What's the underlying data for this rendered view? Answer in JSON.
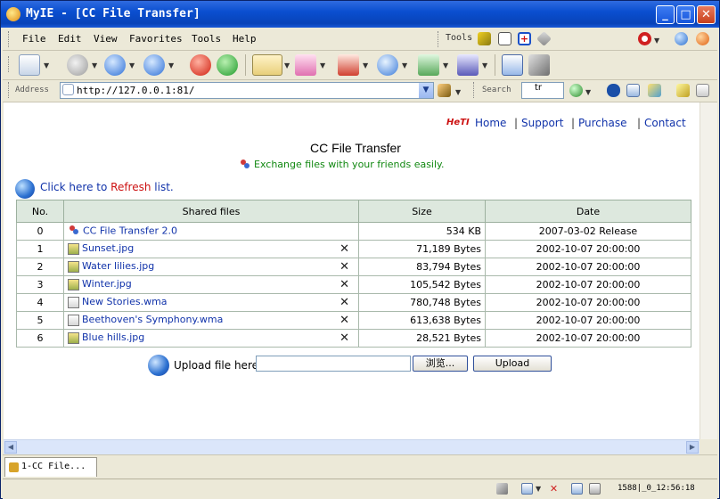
{
  "window": {
    "title": "MyIE - [CC File Transfer]"
  },
  "menu": {
    "items": [
      "File",
      "Edit",
      "View",
      "Favorites",
      "Tools",
      "Help"
    ],
    "tools_label": "Tools"
  },
  "address": {
    "label": "Address",
    "url": "http://127.0.0.1:81/"
  },
  "search": {
    "label": "Search",
    "value": "tr"
  },
  "site": {
    "brand": "HeTI",
    "nav": [
      "Home",
      "Support",
      "Purchase",
      "Contact"
    ],
    "title": "CC File Transfer",
    "tagline": "Exchange files with your friends easily.",
    "refresh_prefix": "Click here to",
    "refresh_link": "Refresh",
    "refresh_suffix": "list."
  },
  "table": {
    "headers": [
      "No.",
      "Shared files",
      "Size",
      "Date"
    ],
    "rows": [
      {
        "no": "0",
        "name": "CC File Transfer 2.0",
        "size": "534 KB",
        "date": "2007-03-02 Release",
        "type": "app",
        "deletable": false
      },
      {
        "no": "1",
        "name": "Sunset.jpg",
        "size": "71,189 Bytes",
        "date": "2002-10-07 20:00:00",
        "type": "img",
        "deletable": true
      },
      {
        "no": "2",
        "name": "Water lilies.jpg",
        "size": "83,794 Bytes",
        "date": "2002-10-07 20:00:00",
        "type": "img",
        "deletable": true
      },
      {
        "no": "3",
        "name": "Winter.jpg",
        "size": "105,542 Bytes",
        "date": "2002-10-07 20:00:00",
        "type": "img",
        "deletable": true
      },
      {
        "no": "4",
        "name": "New Stories.wma",
        "size": "780,748 Bytes",
        "date": "2002-10-07 20:00:00",
        "type": "wma",
        "deletable": true
      },
      {
        "no": "5",
        "name": "Beethoven's Symphony.wma",
        "size": "613,638 Bytes",
        "date": "2002-10-07 20:00:00",
        "type": "wma",
        "deletable": true
      },
      {
        "no": "6",
        "name": "Blue hills.jpg",
        "size": "28,521 Bytes",
        "date": "2002-10-07 20:00:00",
        "type": "img",
        "deletable": true
      }
    ],
    "delete_glyph": "✕"
  },
  "upload": {
    "label": "Upload file here",
    "browse": "浏览...",
    "submit": "Upload"
  },
  "tab": {
    "label": "1-CC File..."
  },
  "status": {
    "text": "1588|_0_12:56:18"
  }
}
